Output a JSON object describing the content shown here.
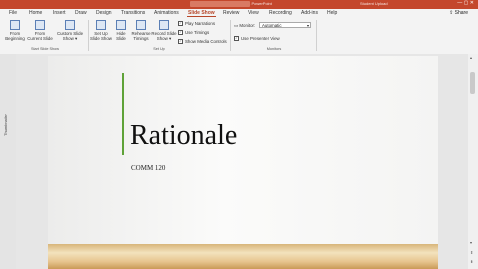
{
  "titlebar": {
    "doc": "Lecture 1.0 Read Show - PowerPoint",
    "search_placeholder": "Search",
    "user": "Student Upload",
    "controls": "—  ▢  ✕"
  },
  "menu": {
    "tabs": [
      "File",
      "Home",
      "Insert",
      "Draw",
      "Design",
      "Transitions",
      "Animations",
      "Slide Show",
      "Review",
      "View",
      "Recording",
      "Add-ins",
      "Help"
    ],
    "active": "Slide Show",
    "share": "Share"
  },
  "ribbon": {
    "start": {
      "from_beginning": "From\nBeginning",
      "from_current": "From\nCurrent Slide",
      "custom": "Custom Slide\nShow ▾",
      "group": "Start Slide Show"
    },
    "setup": {
      "setup_show": "Set Up\nSlide Show",
      "hide_slide": "Hide\nSlide",
      "rehearse": "Rehearse\nTimings",
      "record": "Record Slide\nShow ▾",
      "play_narrations": "Play Narrations",
      "use_timings": "Use Timings",
      "show_media_controls": "Show Media Controls",
      "group": "Set Up"
    },
    "monitors": {
      "monitor_label": "Monitor:",
      "monitor_value": "Automatic",
      "presenter_view": "Use Presenter View",
      "group": "Monitors"
    }
  },
  "thumbnails": {
    "label": "Thumbnails"
  },
  "slide": {
    "title": "Rationale",
    "subtitle": "COMM 120"
  },
  "colors": {
    "accent_bar": "#5fa238",
    "brand": "#c4472c"
  }
}
